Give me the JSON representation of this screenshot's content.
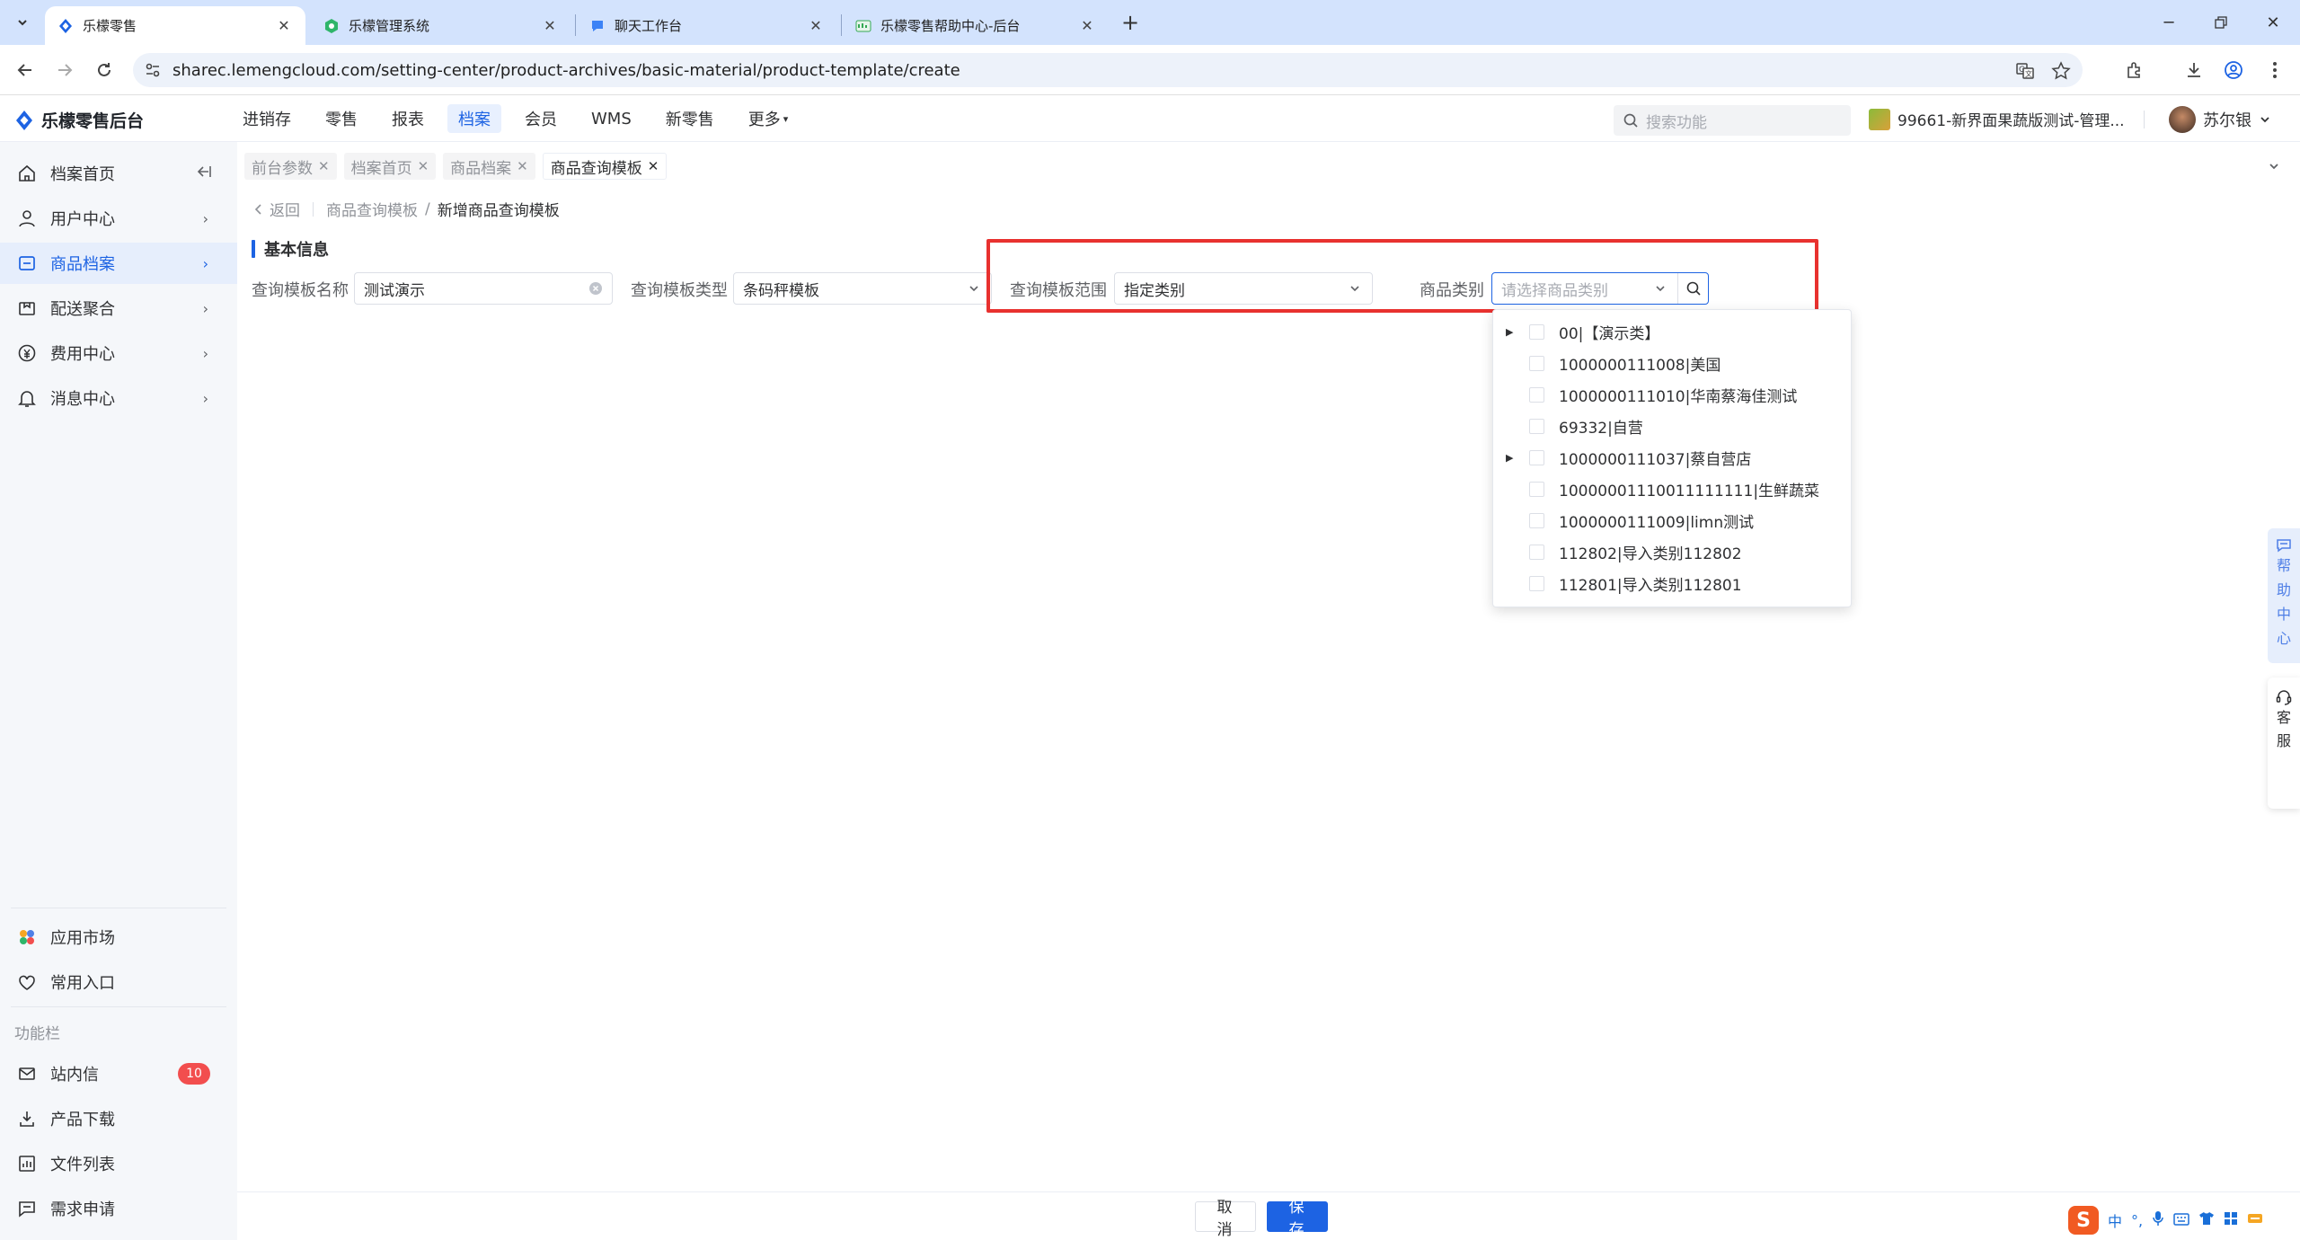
{
  "browser": {
    "tabs": [
      {
        "title": "乐檬零售",
        "active": true
      },
      {
        "title": "乐檬管理系统",
        "active": false
      },
      {
        "title": "聊天工作台",
        "active": false
      },
      {
        "title": "乐檬零售帮助中心-后台",
        "active": false
      }
    ],
    "url": "sharec.lemengcloud.com/setting-center/product-archives/basic-material/product-template/create"
  },
  "header": {
    "logo_text": "乐檬零售后台",
    "nav": [
      {
        "label": "进销存"
      },
      {
        "label": "零售"
      },
      {
        "label": "报表"
      },
      {
        "label": "档案"
      },
      {
        "label": "会员"
      },
      {
        "label": "WMS"
      },
      {
        "label": "新零售"
      },
      {
        "label": "更多"
      }
    ],
    "search_placeholder": "搜索功能",
    "store_name": "99661-新界面果蔬版测试-管理...",
    "user_name": "苏尔银"
  },
  "sidebar": {
    "items": [
      {
        "label": "档案首页"
      },
      {
        "label": "用户中心"
      },
      {
        "label": "商品档案"
      },
      {
        "label": "配送聚合"
      },
      {
        "label": "费用中心"
      },
      {
        "label": "消息中心"
      }
    ],
    "bottom_items": [
      {
        "label": "应用市场"
      },
      {
        "label": "常用入口"
      }
    ],
    "section_title": "功能栏",
    "func_items": [
      {
        "label": "站内信",
        "badge": "10"
      },
      {
        "label": "产品下载"
      },
      {
        "label": "文件列表"
      },
      {
        "label": "需求申请"
      }
    ]
  },
  "page_tabs": [
    {
      "label": "前台参数"
    },
    {
      "label": "档案首页"
    },
    {
      "label": "商品档案"
    },
    {
      "label": "商品查询模板"
    }
  ],
  "breadcrumb": {
    "back": "返回",
    "parent": "商品查询模板",
    "separator": "/",
    "current": "新增商品查询模板"
  },
  "form": {
    "section_title": "基本信息",
    "name_label": "查询模板名称",
    "name_value": "测试演示",
    "type_label": "查询模板类型",
    "type_value": "条码秤模板",
    "scope_label": "查询模板范围",
    "scope_value": "指定类别",
    "category_label": "商品类别",
    "category_placeholder": "请选择商品类别"
  },
  "category_tree": [
    {
      "label": "00|【演示类】",
      "expandable": true
    },
    {
      "label": "1000000111008|美国",
      "expandable": false
    },
    {
      "label": "1000000111010|华南蔡海佳测试",
      "expandable": false
    },
    {
      "label": "69332|自营",
      "expandable": false
    },
    {
      "label": "1000000111037|蔡自营店",
      "expandable": true
    },
    {
      "label": "10000001110011111111|生鲜蔬菜",
      "expandable": false
    },
    {
      "label": "1000000111009|limn测试",
      "expandable": false
    },
    {
      "label": "112802|导入类别112802",
      "expandable": false
    },
    {
      "label": "112801|导入类别112801",
      "expandable": false
    }
  ],
  "float": {
    "help_chars": [
      "帮",
      "助",
      "中",
      "心"
    ],
    "cs_chars": [
      "客",
      "服"
    ]
  },
  "footer": {
    "cancel": "取 消",
    "save": "保 存"
  },
  "ime": {
    "logo": "S",
    "lang": "中"
  },
  "colors": {
    "primary": "#1d63e3",
    "highlight_box": "#e8312f",
    "badge": "#f24e4e"
  }
}
